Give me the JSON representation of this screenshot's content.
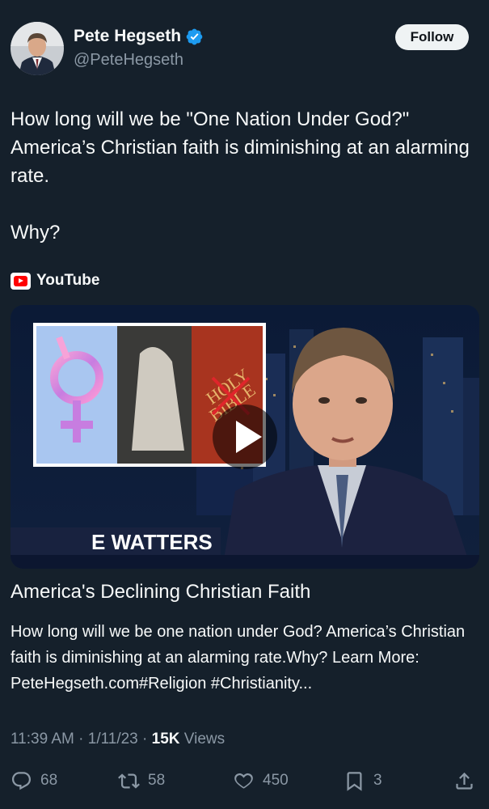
{
  "author": {
    "name": "Pete Hegseth",
    "handle": "@PeteHegseth"
  },
  "follow_label": "Follow",
  "tweet_text": "How long will we be \"One Nation Under God?\" America’s Christian faith is diminishing at an alarming rate.\n\nWhy?",
  "card": {
    "source": "YouTube",
    "thumbnail_text": "E WATTERS",
    "title": "America's Declining Christian Faith",
    "description": "How long will we be one nation under God? America’s Christian faith is diminishing at an alarming rate.Why? Learn More: PeteHegseth.com#Religion #Christianity..."
  },
  "meta": {
    "time": "11:39 AM",
    "sep1": "·",
    "date": "1/11/23",
    "sep2": "·",
    "views_count": "15K",
    "views_label": "Views"
  },
  "actions": {
    "replies": "68",
    "reposts": "58",
    "likes": "450",
    "bookmarks": "3"
  },
  "colors": {
    "background": "#15202b",
    "secondary_text": "#8b98a5",
    "verified": "#1d9bf0",
    "youtube_red": "#ff0000"
  }
}
